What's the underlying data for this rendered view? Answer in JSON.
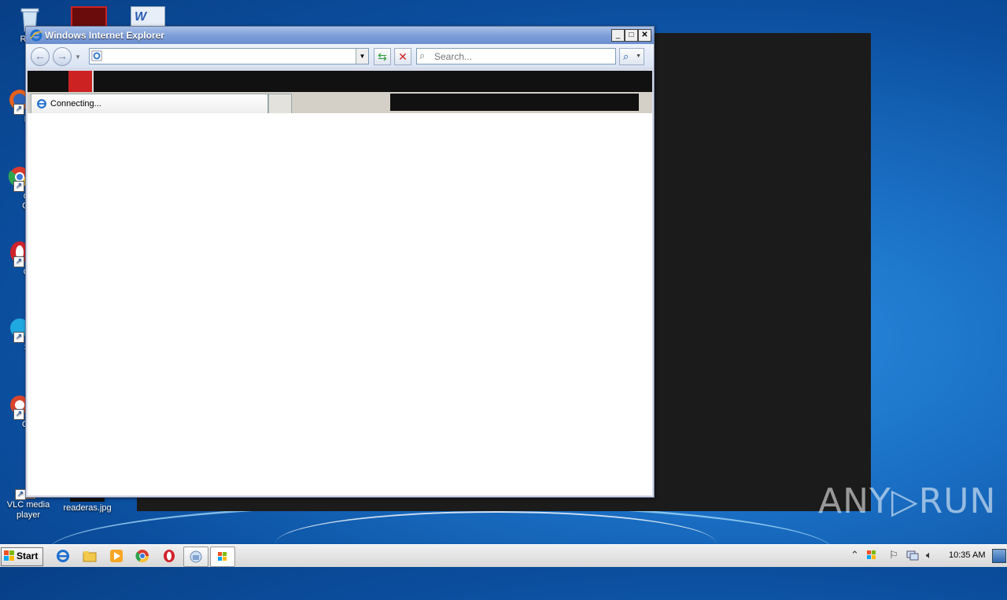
{
  "desktop": {
    "icons": [
      {
        "label": "Recy"
      },
      {
        "label": "Fir"
      },
      {
        "label": "Go"
      },
      {
        "label": "Chr"
      },
      {
        "label": "Op"
      },
      {
        "label": "Sk"
      },
      {
        "label": "CCl"
      },
      {
        "label": "VLC media player"
      },
      {
        "label": "readeras.jpg"
      }
    ]
  },
  "ie": {
    "title": "Windows Internet Explorer",
    "address_value": "",
    "search_placeholder": "Search...",
    "tab_label": "Connecting...",
    "minimize_glyph": "_",
    "maximize_glyph": "□",
    "close_glyph": "✕"
  },
  "taskbar": {
    "start_label": "Start",
    "clock": "10:35 AM"
  },
  "watermark": "ANY▷RUN",
  "colors": {
    "desktop_blue": "#1a6fc4",
    "title_blue": "#7e9fd8",
    "stop_red": "#d22020"
  }
}
